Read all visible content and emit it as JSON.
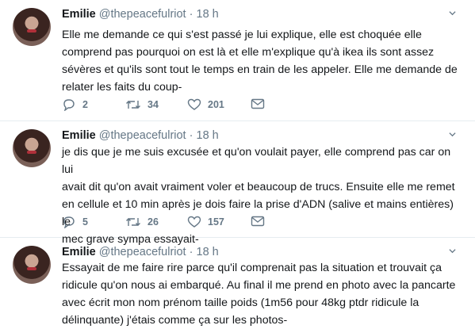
{
  "tweets": [
    {
      "name": "Emilie",
      "handle": "@thepeacefulriot",
      "separator": "·",
      "time": "18 h",
      "lines": [
        "Elle me demande ce qui s'est passé je lui explique, elle est choquée elle",
        "comprend pas pourquoi on est là et elle m'explique qu'à ikea ils sont assez",
        "sévères et qu'ils sont tout le temps en train de les appeler. Elle me demande de",
        "relater les faits du coup-"
      ],
      "replies": "2",
      "retweets": "34",
      "likes": "201"
    },
    {
      "name": "Emilie",
      "handle": "@thepeacefulriot",
      "separator": "·",
      "time": "18 h",
      "lines": [
        "je dis que je me suis excusée et qu'on voulait payer, elle comprend pas car on lui",
        "avait dit qu'on avait vraiment voler et beaucoup de trucs. Ensuite elle me remet",
        "en cellule et 10 min après je dois faire la prise d'ADN (salive et mains entières) le",
        "mec grave sympa essayait-"
      ],
      "replies": "5",
      "retweets": "26",
      "likes": "157"
    },
    {
      "name": "Emilie",
      "handle": "@thepeacefulriot",
      "separator": "·",
      "time": "18 h",
      "lines": [
        "Essayait de me faire rire parce qu'il comprenait pas la situation et trouvait ça",
        "ridicule qu'on nous ai embarqué. Au final il me prend en photo avec la pancarte",
        "avec écrit mon nom prénom taille poids (1m56 pour 48kg ptdr ridicule la",
        "délinquante) j'étais comme ça sur les photos-"
      ]
    }
  ],
  "icons": {
    "reply": "reply-icon",
    "retweet": "retweet-icon",
    "like": "heart-icon",
    "dm": "envelope-icon",
    "menu": "chevron-down-icon"
  },
  "colors": {
    "text": "#14171a",
    "muted": "#657786",
    "divider": "#e6ecf0"
  }
}
